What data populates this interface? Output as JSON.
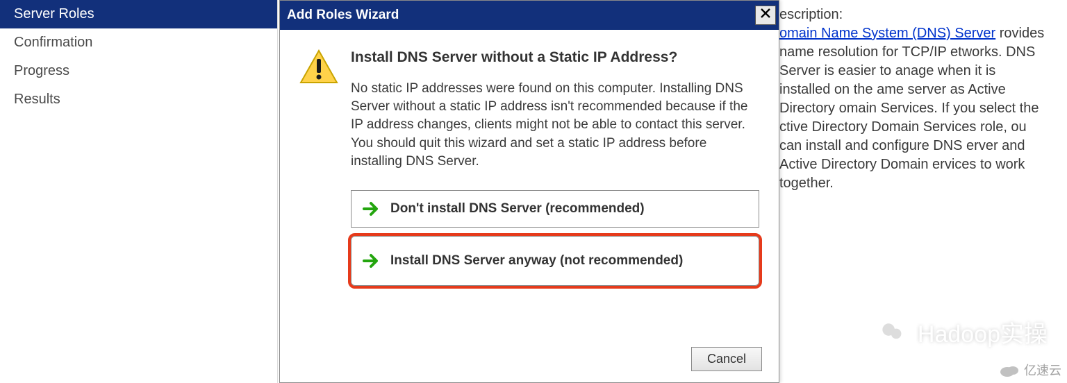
{
  "sidebar": {
    "items": [
      {
        "label": "Server Roles",
        "selected": true
      },
      {
        "label": "Confirmation",
        "selected": false
      },
      {
        "label": "Progress",
        "selected": false
      },
      {
        "label": "Results",
        "selected": false
      }
    ]
  },
  "description": {
    "label": "escription:",
    "link_text": "omain Name System (DNS) Server",
    "body": "rovides name resolution for TCP/IP etworks. DNS Server is easier to anage when it is installed on the ame server as Active Directory omain Services. If you select the ctive Directory Domain Services role, ou can install and configure DNS erver and Active Directory Domain ervices to work together."
  },
  "dialog": {
    "title": "Add Roles Wizard",
    "heading": "Install DNS Server without a Static IP Address?",
    "message": "No static IP addresses were found on this computer. Installing DNS Server without a static IP address isn't recommended because if the IP address changes, clients might not be able to contact this server. You should quit this wizard and set a static IP address before installing DNS Server.",
    "options": [
      {
        "label": "Don't install DNS Server (recommended)",
        "highlighted": false
      },
      {
        "label": "Install DNS Server anyway (not recommended)",
        "highlighted": true
      }
    ],
    "cancel_label": "Cancel"
  },
  "watermarks": {
    "a": "Hadoop实操",
    "b": "亿速云"
  }
}
